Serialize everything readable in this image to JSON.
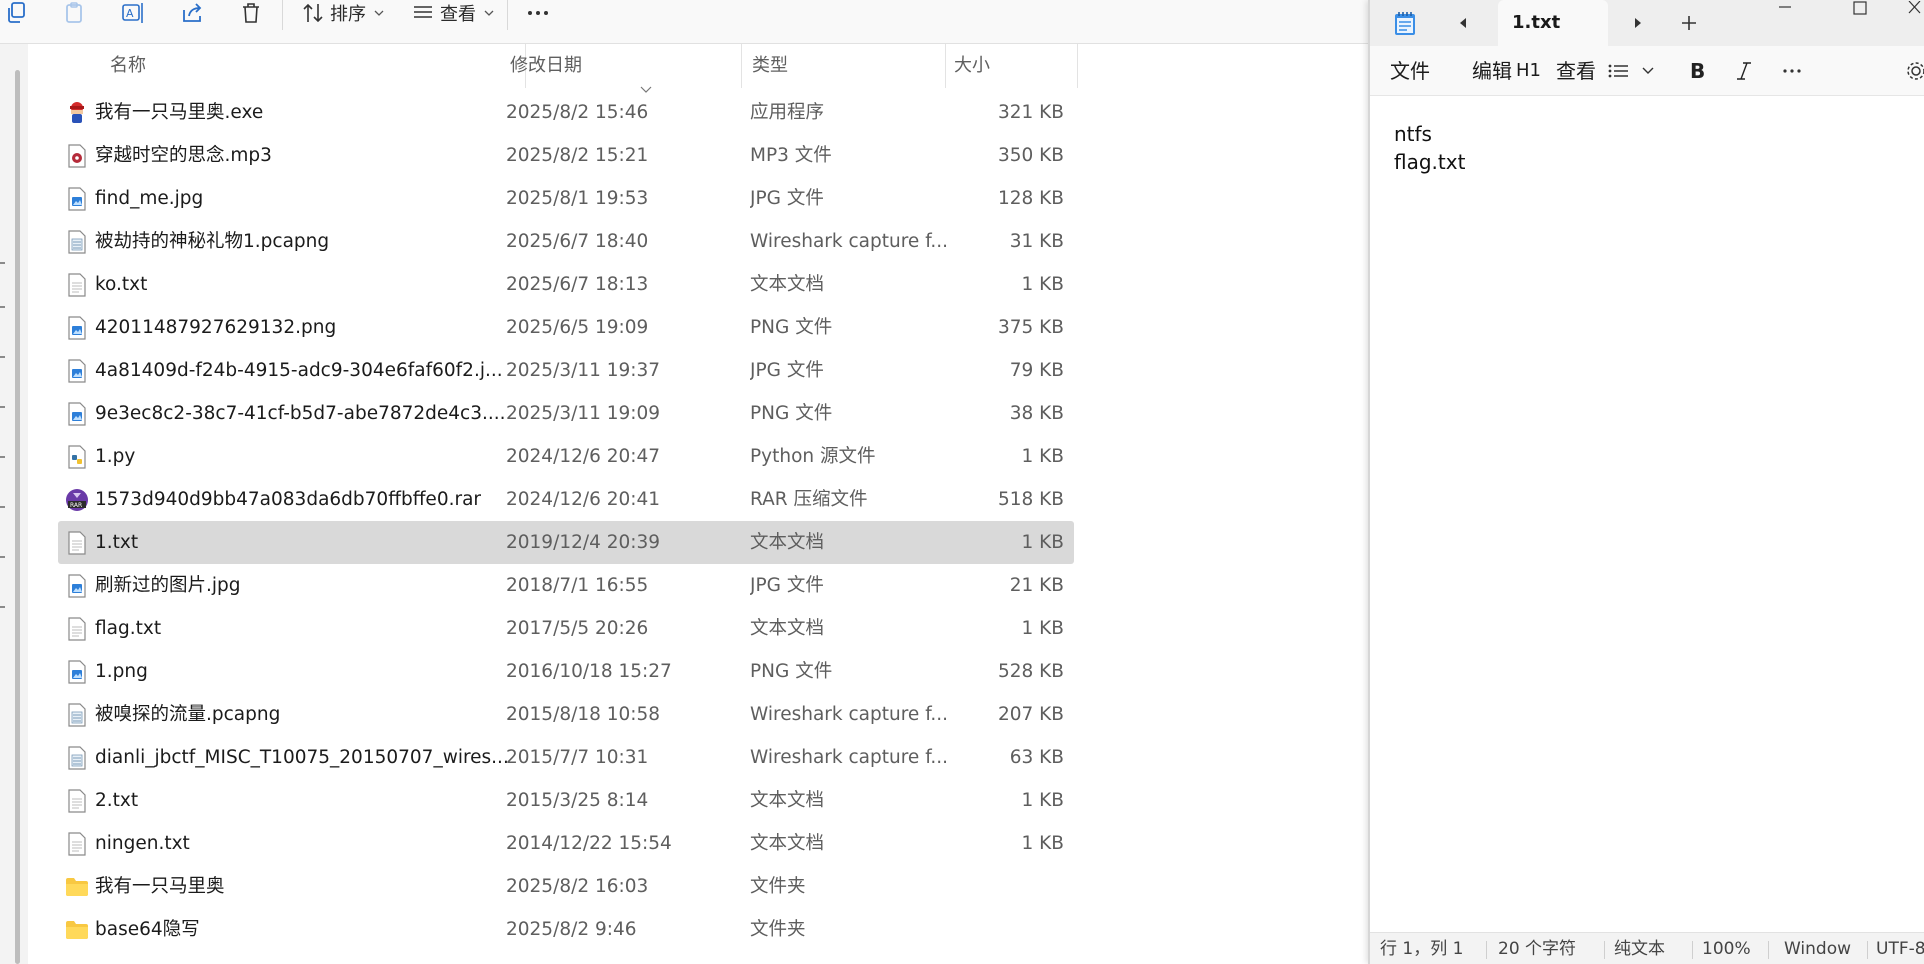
{
  "toolbar": {
    "sort_label": "排序",
    "view_label": "查看"
  },
  "columns": {
    "name": "名称",
    "date": "修改日期",
    "type": "类型",
    "size": "大小"
  },
  "files": [
    {
      "name": "我有一只马里奥.exe",
      "date": "2025/8/2 15:46",
      "type": "应用程序",
      "size": "321 KB",
      "icon": "exe-icon"
    },
    {
      "name": "穿越时空的思念.mp3",
      "date": "2025/8/2 15:21",
      "type": "MP3 文件",
      "size": "350 KB",
      "icon": "audio-file-icon"
    },
    {
      "name": "find_me.jpg",
      "date": "2025/8/1 19:53",
      "type": "JPG 文件",
      "size": "128 KB",
      "icon": "image-file-icon"
    },
    {
      "name": "被劫持的神秘礼物1.pcapng",
      "date": "2025/6/7 18:40",
      "type": "Wireshark capture f...",
      "size": "31 KB",
      "icon": "capture-file-icon"
    },
    {
      "name": "ko.txt",
      "date": "2025/6/7 18:13",
      "type": "文本文档",
      "size": "1 KB",
      "icon": "text-file-icon"
    },
    {
      "name": "42011487927629132.png",
      "date": "2025/6/5 19:09",
      "type": "PNG 文件",
      "size": "375 KB",
      "icon": "image-file-icon"
    },
    {
      "name": "4a81409d-f24b-4915-adc9-304e6faf60f2.j...",
      "date": "2025/3/11 19:37",
      "type": "JPG 文件",
      "size": "79 KB",
      "icon": "image-file-icon"
    },
    {
      "name": "9e3ec8c2-38c7-41cf-b5d7-abe7872de4c3....",
      "date": "2025/3/11 19:09",
      "type": "PNG 文件",
      "size": "38 KB",
      "icon": "image-file-icon"
    },
    {
      "name": "1.py",
      "date": "2024/12/6 20:47",
      "type": "Python 源文件",
      "size": "1 KB",
      "icon": "python-file-icon"
    },
    {
      "name": "1573d940d9bb47a083da6db70ffbffe0.rar",
      "date": "2024/12/6 20:41",
      "type": "RAR 压缩文件",
      "size": "518 KB",
      "icon": "rar-file-icon"
    },
    {
      "name": "1.txt",
      "date": "2019/12/4 20:39",
      "type": "文本文档",
      "size": "1 KB",
      "icon": "text-file-icon",
      "selected": true
    },
    {
      "name": "刷新过的图片.jpg",
      "date": "2018/7/1 16:55",
      "type": "JPG 文件",
      "size": "21 KB",
      "icon": "image-file-icon"
    },
    {
      "name": "flag.txt",
      "date": "2017/5/5 20:26",
      "type": "文本文档",
      "size": "1 KB",
      "icon": "text-file-icon"
    },
    {
      "name": "1.png",
      "date": "2016/10/18 15:27",
      "type": "PNG 文件",
      "size": "528 KB",
      "icon": "image-file-icon"
    },
    {
      "name": "被嗅探的流量.pcapng",
      "date": "2015/8/18 10:58",
      "type": "Wireshark capture f...",
      "size": "207 KB",
      "icon": "capture-file-icon"
    },
    {
      "name": "dianli_jbctf_MISC_T10075_20150707_wires...",
      "date": "2015/7/7 10:31",
      "type": "Wireshark capture f...",
      "size": "63 KB",
      "icon": "capture-file-icon"
    },
    {
      "name": "2.txt",
      "date": "2015/3/25 8:14",
      "type": "文本文档",
      "size": "1 KB",
      "icon": "text-file-icon"
    },
    {
      "name": "ningen.txt",
      "date": "2014/12/22 15:54",
      "type": "文本文档",
      "size": "1 KB",
      "icon": "text-file-icon"
    },
    {
      "name": "我有一只马里奥",
      "date": "2025/8/2 16:03",
      "type": "文件夹",
      "size": "",
      "icon": "folder-icon"
    },
    {
      "name": "base64隐写",
      "date": "2025/8/2 9:46",
      "type": "文件夹",
      "size": "",
      "icon": "folder-icon"
    }
  ],
  "notepad": {
    "tab_title": "1.txt",
    "menu": {
      "file": "文件",
      "edit": "编辑",
      "heading": "H1",
      "view": "查看"
    },
    "content_lines": [
      "ntfs",
      "flag.txt"
    ],
    "status": {
      "position": "行 1，列 1",
      "chars": "20 个字符",
      "format": "纯文本",
      "zoom": "100%",
      "line_ending": "Window",
      "encoding": "UTF-8"
    }
  },
  "colors": {
    "selected_row": "#d9d9d9",
    "folder": "#f8c842",
    "notepad_icon": "#2a7fd4"
  }
}
